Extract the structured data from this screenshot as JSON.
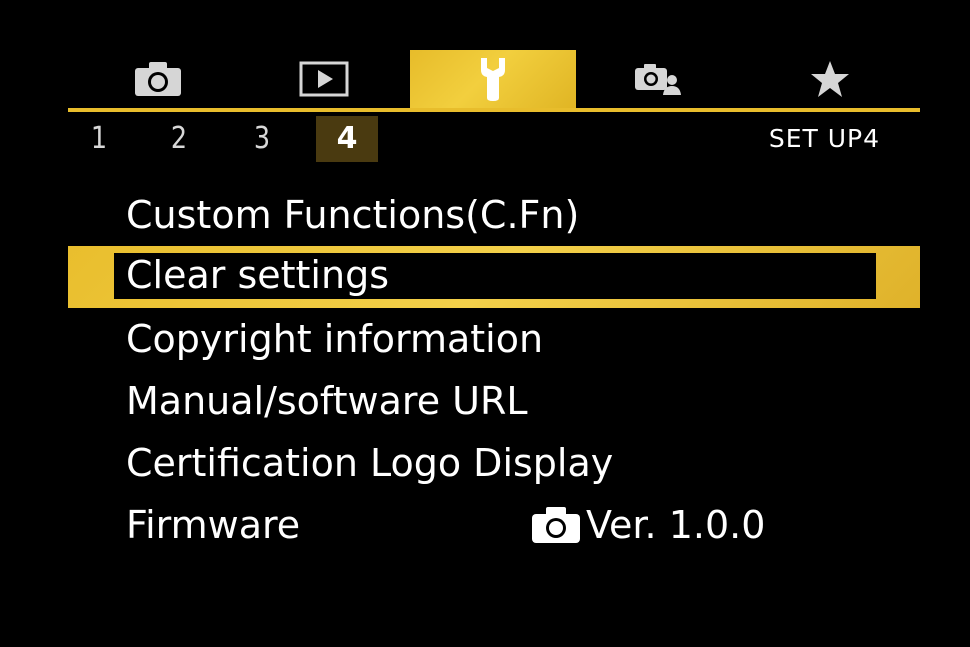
{
  "colors": {
    "accent": "#e8bd2c",
    "background": "#000000",
    "text": "#ffffff",
    "active_page_bg": "#4a3a10"
  },
  "tabs": [
    {
      "icon": "camera-icon",
      "active": false
    },
    {
      "icon": "playback-icon",
      "active": false
    },
    {
      "icon": "wrench-icon",
      "active": true
    },
    {
      "icon": "custom-camera-icon",
      "active": false
    },
    {
      "icon": "star-icon",
      "active": false
    }
  ],
  "pages": {
    "numbers": [
      "1",
      "2",
      "3",
      "4"
    ],
    "active": "4",
    "label": "SET UP4"
  },
  "menu": {
    "items": [
      {
        "label": "Custom Functions(C.Fn)"
      },
      {
        "label": "Clear settings",
        "selected": true
      },
      {
        "label": "Copyright information"
      },
      {
        "label": "Manual/software URL"
      },
      {
        "label": "Certification Logo Display"
      },
      {
        "label": "Firmware",
        "value": "Ver. 1.0.0",
        "value_icon": "camera-icon"
      }
    ]
  }
}
